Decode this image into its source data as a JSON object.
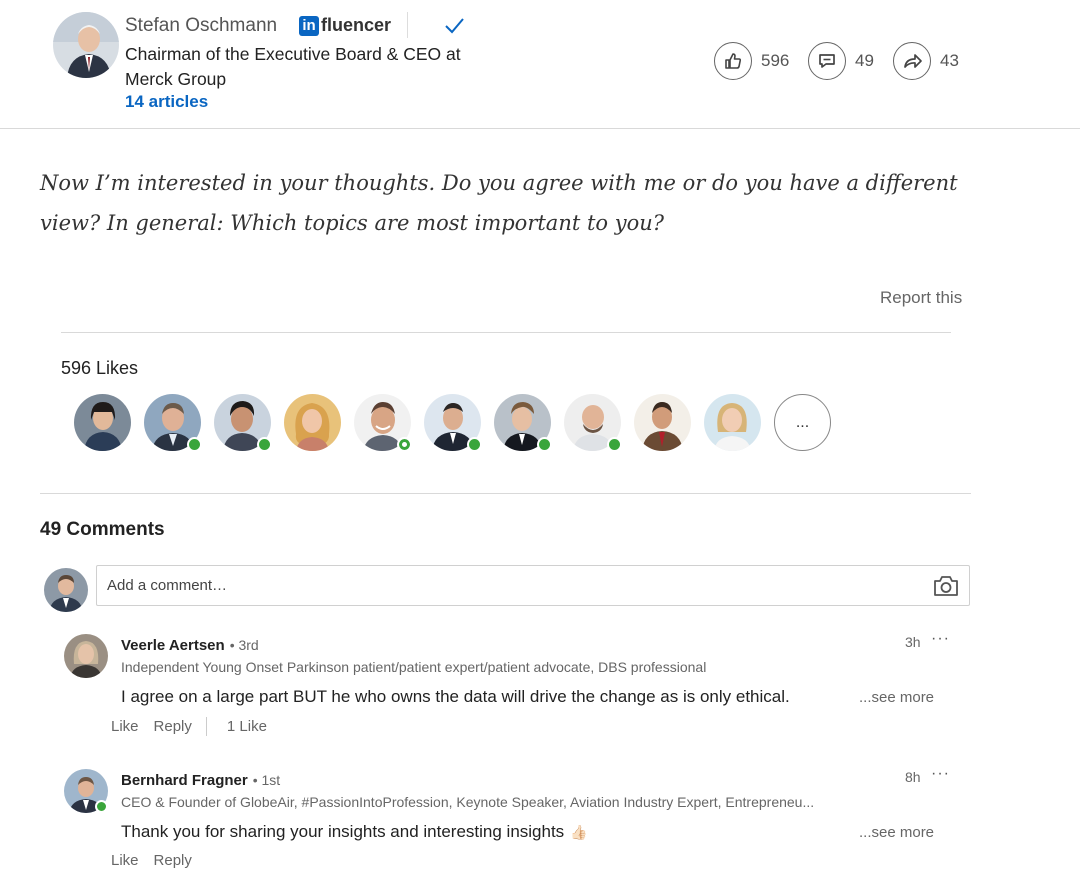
{
  "author": {
    "name": "Stefan Oschmann",
    "badge": "fluencer",
    "badge_prefix": "in",
    "headline": "Chairman of the Executive Board & CEO at Merck Group",
    "articles": "14 articles"
  },
  "social_counts": {
    "likes": "596",
    "comments": "49",
    "shares": "43"
  },
  "article": {
    "closing_text": "Now I’m interested in your thoughts. Do you agree with me or do you have a different view? In general: Which topics are most important to you?",
    "report_label": "Report this"
  },
  "likes": {
    "title": "596 Likes",
    "more_label": "...",
    "avatars": [
      {
        "icon": "avatar-icon",
        "online": "none"
      },
      {
        "icon": "avatar-icon",
        "online": "active"
      },
      {
        "icon": "avatar-icon",
        "online": "active"
      },
      {
        "icon": "avatar-icon",
        "online": "none"
      },
      {
        "icon": "avatar-icon",
        "online": "idle"
      },
      {
        "icon": "avatar-icon",
        "online": "active"
      },
      {
        "icon": "avatar-icon",
        "online": "active"
      },
      {
        "icon": "avatar-icon",
        "online": "active"
      },
      {
        "icon": "avatar-icon",
        "online": "none"
      },
      {
        "icon": "avatar-icon",
        "online": "none"
      }
    ]
  },
  "comments": {
    "title": "49 Comments",
    "input_placeholder": "Add a comment…",
    "items": [
      {
        "name": "Veerle Aertsen",
        "degree": "• 3rd",
        "headline": "Independent Young Onset Parkinson patient/patient expert/patient advocate, DBS professional",
        "text": "I agree on a large part BUT he who owns the data will drive the change as is only ethical.",
        "time": "3h",
        "more": "···",
        "see_more": "...see more",
        "like_label": "Like",
        "reply_label": "Reply",
        "likes_count": "1 Like"
      },
      {
        "name": "Bernhard Fragner",
        "degree": "• 1st",
        "headline": "CEO & Founder of GlobeAir, #PassionIntoProfession, Keynote Speaker, Aviation Industry Expert, Entrepreneu...",
        "text": "Thank you for sharing your insights and interesting insights",
        "emoji": "👍🏻",
        "time": "8h",
        "more": "···",
        "see_more": "...see more",
        "like_label": "Like",
        "reply_label": "Reply"
      }
    ]
  },
  "colors": {
    "accent": "#0a66c2",
    "online": "#3aa53b"
  }
}
